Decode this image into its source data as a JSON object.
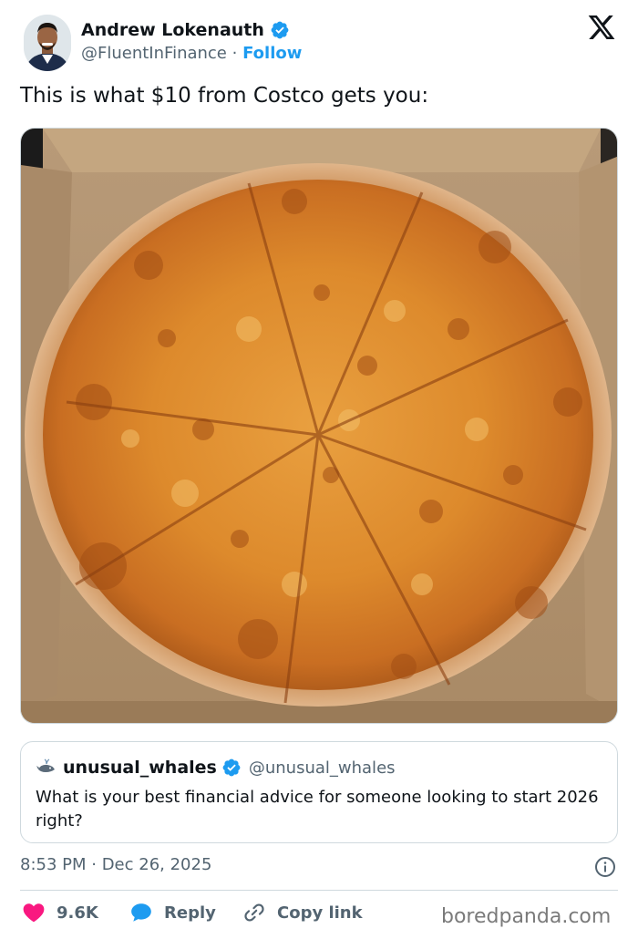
{
  "author": {
    "name": "Andrew Lokenauth",
    "handle": "@FluentInFinance",
    "separator": "·",
    "follow_label": "Follow"
  },
  "tweet": {
    "text": "This is what $10 from Costco gets you:",
    "photo_alt": "pizza-photo"
  },
  "quote": {
    "name": "unusual_whales",
    "handle": "@unusual_whales",
    "text": "What is your best financial advice for someone looking to start 2026 right?"
  },
  "meta": {
    "timestamp": "8:53 PM · Dec 26, 2025"
  },
  "actions": {
    "likes": "9.6K",
    "reply_label": "Reply",
    "copy_label": "Copy link"
  },
  "watermark": "boredpanda.com",
  "colors": {
    "accent": "#1d9bf0",
    "like": "#f91880",
    "text": "#0f1419",
    "muted": "#536471",
    "border": "#cfd9de"
  },
  "icons": [
    "verified-badge-icon",
    "x-logo-icon",
    "whale-icon",
    "info-icon",
    "heart-icon",
    "reply-bubble-icon",
    "link-icon"
  ]
}
